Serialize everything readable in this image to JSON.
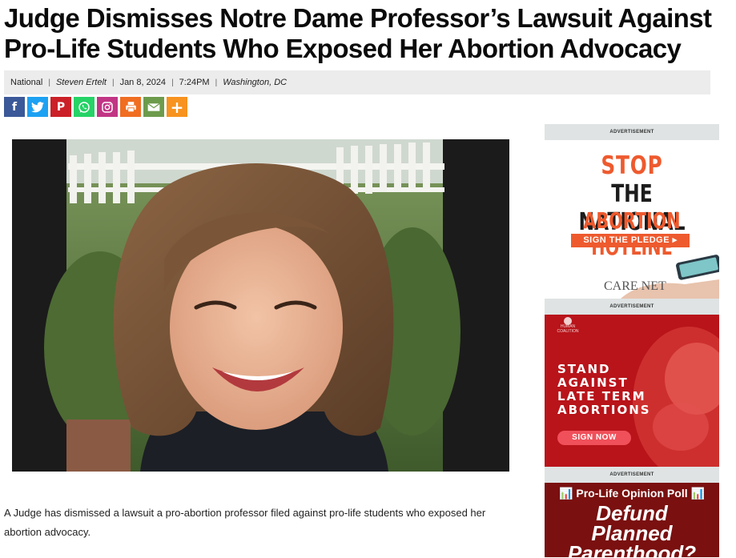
{
  "article": {
    "headline": "Judge Dismisses Notre Dame Professor’s Lawsuit Against Pro-Life Students Who Exposed Her Abortion Advocacy",
    "category": "National",
    "author": "Steven Ertelt",
    "date": "Jan 8, 2024",
    "time": "7:24PM",
    "location": "Washington, DC",
    "lead_paragraph": "A Judge has dismissed a lawsuit a pro-abortion professor filed against pro-life students who exposed her abortion advocacy."
  },
  "share_buttons": [
    {
      "name": "facebook",
      "glyph": "f",
      "color": "#3b5998"
    },
    {
      "name": "twitter",
      "glyph": "t",
      "color": "#1da1f2"
    },
    {
      "name": "pinterest",
      "glyph": "P",
      "color": "#cb2027"
    },
    {
      "name": "whatsapp",
      "glyph": "✆",
      "color": "#25d366"
    },
    {
      "name": "instagram",
      "glyph": "◎",
      "color": "#c13584"
    },
    {
      "name": "print",
      "glyph": "⎙",
      "color": "#f06d21"
    },
    {
      "name": "email",
      "glyph": "✉",
      "color": "#6d9b4c"
    },
    {
      "name": "more",
      "glyph": "+",
      "color": "#f7931e"
    }
  ],
  "sidebar": {
    "ad_label": "ADVERTISEMENT",
    "ad1": {
      "line1": "STOP",
      "line2": "THE NATIONAL",
      "line3": "ABORTION HOTLINE",
      "button": "SIGN THE PLEDGE ▸",
      "logo": "CARE NET"
    },
    "ad2": {
      "brand": "HUMAN COALITION",
      "line1": "STAND",
      "line2": "AGAINST",
      "line3": "LATE TERM",
      "line4": "ABORTIONS",
      "button": "SIGN NOW"
    },
    "ad3": {
      "poll": "📊 Pro-Life Opinion Poll 📊",
      "title_line1": "Defund",
      "title_line2": "Planned",
      "title_line3": "Parenthood?"
    }
  }
}
